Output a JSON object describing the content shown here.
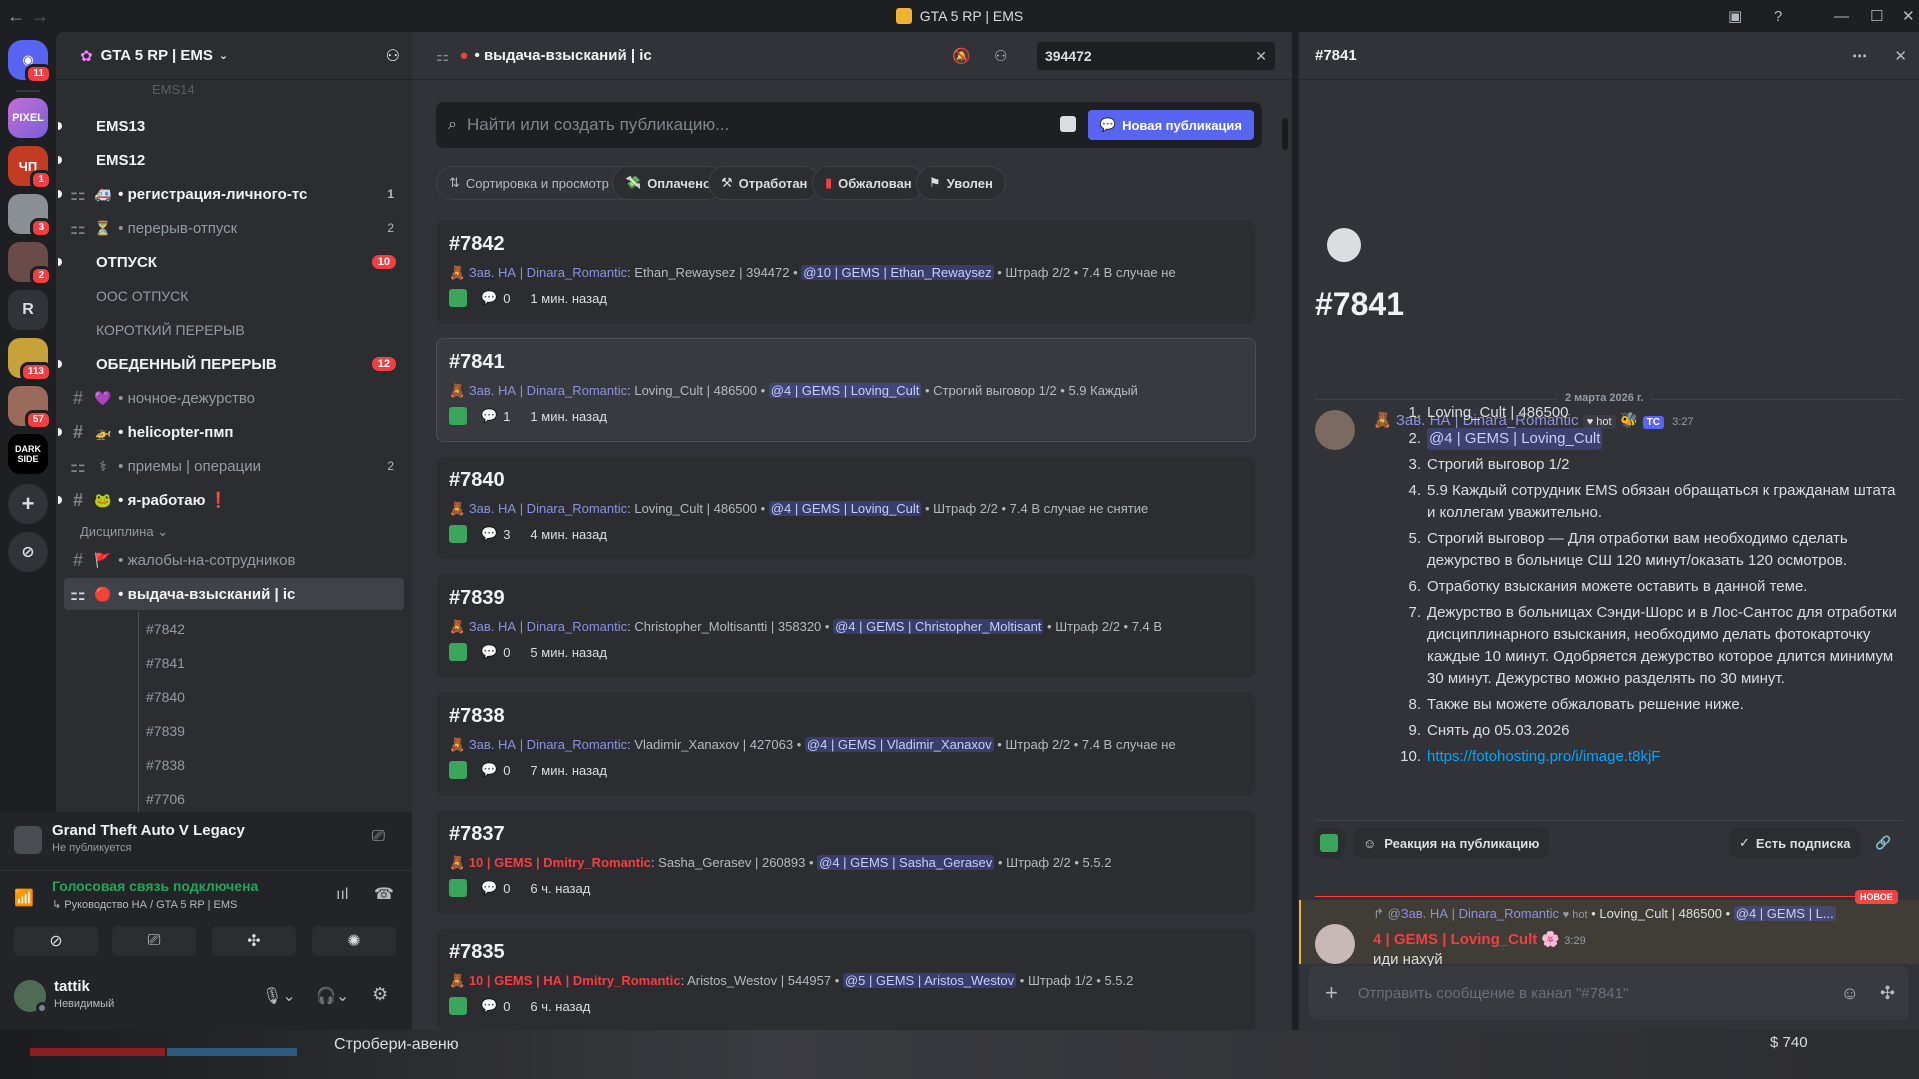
{
  "window": {
    "title": "GTA 5 RP | EMS"
  },
  "servers": [
    {
      "label": "",
      "badge": "11"
    },
    {
      "label": "PIXEL",
      "badge": ""
    },
    {
      "label": "ЧП",
      "badge": "1"
    },
    {
      "label": "",
      "badge": "3"
    },
    {
      "label": "",
      "badge": "2"
    },
    {
      "label": "R",
      "badge": ""
    },
    {
      "label": "",
      "badge": "113"
    },
    {
      "label": "",
      "badge": "57"
    },
    {
      "label": "DARK SIDE",
      "badge": ""
    }
  ],
  "sidebar": {
    "server_name": "GTA 5 RP | EMS",
    "channels": [
      {
        "label": "EMS13",
        "type": "category",
        "unread": true
      },
      {
        "label": "EMS12",
        "type": "category",
        "unread": true
      },
      {
        "label": "регистрация-личного-тс",
        "type": "forum",
        "emoji": "🚑",
        "count": "1",
        "unread": true
      },
      {
        "label": "перерыв-отпуск",
        "type": "forum",
        "emoji": "⏳",
        "count": "2"
      },
      {
        "label": "ОТПУСК",
        "type": "category",
        "red_count": "10",
        "unread": true
      },
      {
        "label": "ООС ОТПУСК",
        "type": "plain"
      },
      {
        "label": "КОРОТКИЙ ПЕРЕРЫВ",
        "type": "plain"
      },
      {
        "label": "ОБЕДЕННЫЙ ПЕРЕРЫВ",
        "type": "category",
        "red_count": "12",
        "unread": true
      },
      {
        "label": "ночное-дежурство",
        "type": "text",
        "emoji": "💜"
      },
      {
        "label": "helicopter-пмп",
        "type": "text",
        "emoji": "🚁",
        "unread": true
      },
      {
        "label": "приемы | операции",
        "type": "forum",
        "emoji": "⚕",
        "count": "2"
      },
      {
        "label": "я-работаю",
        "type": "text",
        "emoji": "🐸",
        "unread": true,
        "suffix": "❗"
      }
    ],
    "category_discipline": "Дисциплина",
    "discipline_channels": [
      {
        "label": "жалобы-на-сотрудников",
        "type": "text",
        "emoji": "🚩"
      },
      {
        "label": "выдача-взысканий | ic",
        "type": "forum",
        "emoji": "🔴",
        "active": true
      }
    ],
    "threads": [
      "#7842",
      "#7841",
      "#7840",
      "#7839",
      "#7838",
      "#7706"
    ]
  },
  "activity": {
    "game": "Grand Theft Auto V Legacy",
    "game_status": "Не публикуется",
    "voice_status": "Голосовая связь подключена",
    "voice_channel": "Руководство НА / GTA 5 RP | EMS",
    "username": "tattik",
    "user_status": "Невидимый"
  },
  "forum": {
    "channel_title": "выдача-взысканий | ic",
    "search_value": "394472",
    "find_placeholder": "Найти или создать публикацию...",
    "new_post_label": "Новая публикация",
    "sort_label": "Сортировка и просмотр",
    "filters": [
      "Оплачено",
      "Отработан",
      "Обжалован",
      "Уволен"
    ],
    "posts": [
      {
        "title": "#7842",
        "author": "Зав. НА | Dinara_Romantic",
        "author_red": false,
        "text": ": Ethan_Rewaysez | 394472 •",
        "mention": "@10 | GEMS | Ethan_Rewaysez",
        "tail": "• Штраф 2/2 • 7.4 В случае не",
        "replies": "0",
        "time": "1 мин. назад"
      },
      {
        "title": "#7841",
        "author": "Зав. НА | Dinara_Romantic",
        "author_red": false,
        "text": ": Loving_Cult | 486500 •",
        "mention": "@4 | GEMS | Loving_Cult",
        "tail": "• Строгий выговор 1/2 • 5.9 Каждый",
        "replies": "1",
        "time": "1 мин. назад"
      },
      {
        "title": "#7840",
        "author": "Зав. НА | Dinara_Romantic",
        "author_red": false,
        "text": ": Loving_Cult | 486500 •",
        "mention": "@4 | GEMS | Loving_Cult",
        "tail": "• Штраф 2/2 • 7.4 В случае не снятие",
        "replies": "3",
        "time": "4 мин. назад"
      },
      {
        "title": "#7839",
        "author": "Зав. НА | Dinara_Romantic",
        "author_red": false,
        "text": ": Christopher_Moltisantti | 358320 •",
        "mention": "@4 | GEMS | Christopher_Moltisant",
        "tail": "• Штраф 2/2 • 7.4 В",
        "replies": "0",
        "time": "5 мин. назад"
      },
      {
        "title": "#7838",
        "author": "Зав. НА | Dinara_Romantic",
        "author_red": false,
        "text": ": Vladimir_Xanaxov | 427063 •",
        "mention": "@4 | GEMS | Vladimir_Xanaxov",
        "tail": "• Штраф 2/2 • 7.4 В случае не",
        "replies": "0",
        "time": "7 мин. назад"
      },
      {
        "title": "#7837",
        "author": "10 | GEMS | Dmitry_Romantic",
        "author_red": true,
        "text": ": Sasha_Gerasev | 260893 •",
        "mention": "@4 | GEMS | Sasha_Gerasev",
        "tail": "• Штраф 2/2 • 5.5.2",
        "replies": "0",
        "time": "6 ч. назад"
      },
      {
        "title": "#7835",
        "author": "10 | GEMS | НА | Dmitry_Romantic",
        "author_red": true,
        "text": ": Aristos_Westov | 544957 •",
        "mention": "@5 | GEMS | Aristos_Westov",
        "tail": "• Штраф 1/2 • 5.5.2",
        "replies": "0",
        "time": "6 ч. назад"
      }
    ]
  },
  "thread": {
    "header_title": "#7841",
    "big_title": "#7841",
    "date_divider": "2 марта 2026 г.",
    "author": "Зав. НА | Dinara_Romantic",
    "author_tag": "hot",
    "author_tc": "TC",
    "time": "3:27",
    "items": [
      {
        "n": "1.",
        "text": "Loving_Cult | 486500"
      },
      {
        "n": "2.",
        "text": "@4 | GEMS | Loving_Cult",
        "mention": true
      },
      {
        "n": "3.",
        "text": "Строгий выговор 1/2"
      },
      {
        "n": "4.",
        "text": "5.9 Каждый сотрудник EMS обязан обращаться к гражданам штата и коллегам уважительно."
      },
      {
        "n": "5.",
        "text": "Строгий выговор — Для отработки вам необходимо сделать дежурство в больнице СШ 120 минут/оказать 120 осмотров."
      },
      {
        "n": "6.",
        "text": "Отработку взыскания можете оставить в данной теме."
      },
      {
        "n": "7.",
        "text": "Дежурство в больницах Сэнди-Шорс и в Лос-Сантос для отработки дисциплинарного взыскания, необходимо делать фотокарточку каждые 10 минут. Одобряется дежурство которое длится минимум 30 минут. Дежурство можно разделять по 30 минут."
      },
      {
        "n": "8.",
        "text": "Также вы можете обжаловать решение ниже."
      },
      {
        "n": "9.",
        "text": "Снять до 05.03.2026"
      },
      {
        "n": "10.",
        "text": "https://fotohosting.pro/i/image.t8kjF",
        "link": true
      }
    ],
    "reaction_label": "Реакция на публикацию",
    "subscribed_label": "Есть подписка",
    "new_label": "НОВОЕ",
    "reply_ref_author": "Зав. НА | Dinara_Romantic",
    "reply_ref_tag": "hot",
    "reply_ref_text": "• Loving_Cult | 486500 •",
    "reply_ref_mention": "@4 | GEMS | L...",
    "reply_author": "4 | GEMS | Loving_Cult",
    "reply_time": "3:29",
    "reply_text": "иди нахуй",
    "composer_placeholder": "Отправить сообщение в канал \"#7841\""
  },
  "game_overlay": {
    "street": "Стробери-авеню",
    "money": "$ 740"
  },
  "colors": {
    "accent": "#5865f2",
    "danger": "#f23f43",
    "online": "#23a55a",
    "link": "#00a8fc"
  }
}
